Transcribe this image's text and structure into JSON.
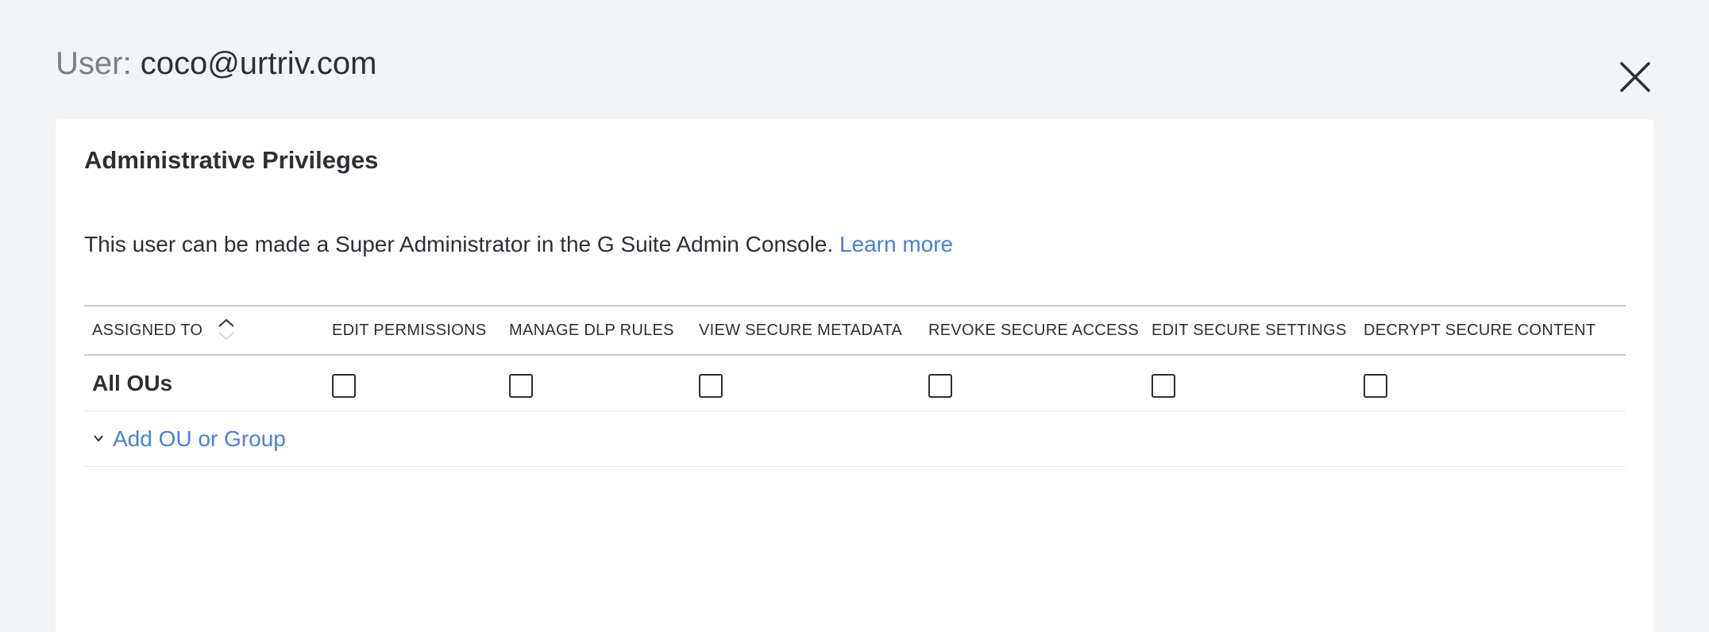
{
  "header": {
    "prefix": "User:",
    "email": "coco@urtriv.com"
  },
  "card": {
    "title": "Administrative Privileges",
    "info_text": "This user can be made a Super Administrator in the G Suite Admin Console.",
    "learn_more": "Learn more"
  },
  "table": {
    "columns": [
      "ASSIGNED TO",
      "EDIT PERMISSIONS",
      "MANAGE DLP RULES",
      "VIEW SECURE METADATA",
      "REVOKE SECURE ACCESS",
      "EDIT SECURE SETTINGS",
      "DECRYPT SECURE CONTENT"
    ],
    "rows": [
      {
        "label": "All OUs",
        "checked": [
          false,
          false,
          false,
          false,
          false,
          false
        ]
      }
    ],
    "add_label": "Add OU or Group"
  },
  "icons": {
    "close": "close-icon",
    "sort": "sort-icon",
    "chevron": "chevron-down-icon"
  },
  "colors": {
    "background": "#f3f4f6",
    "card": "#ffffff",
    "link": "#4a80d8",
    "text": "#2b2f36",
    "muted": "#7b7f87"
  }
}
